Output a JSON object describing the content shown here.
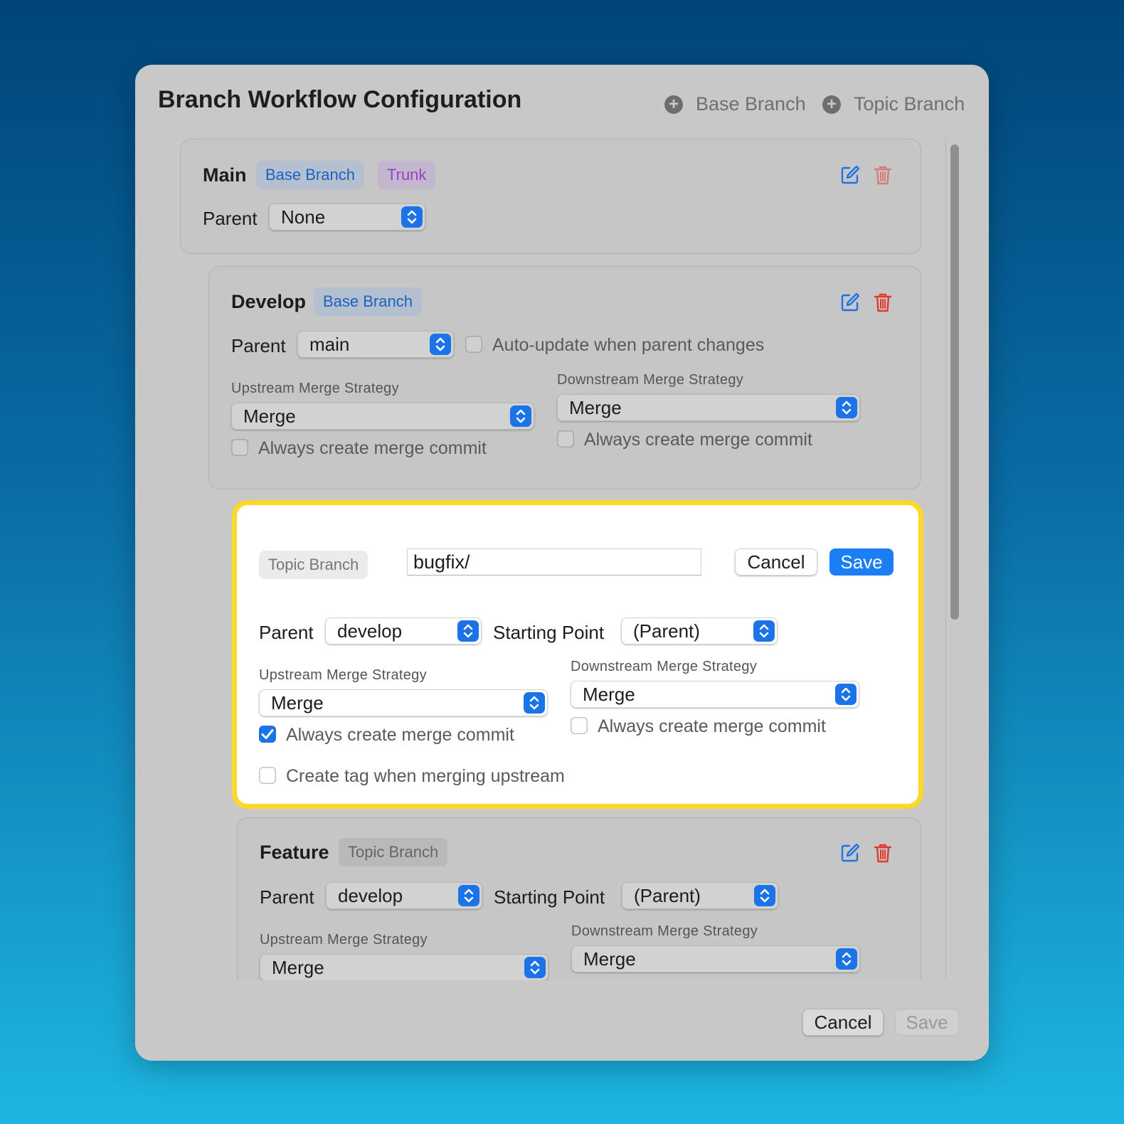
{
  "window": {
    "title": "Branch Workflow Configuration",
    "add_base_label": "Base Branch",
    "add_topic_label": "Topic Branch"
  },
  "colors": {
    "accent": "#1b73e8",
    "highlight_border": "#fcd928",
    "delete_red": "#e03a2e",
    "trunk_purple": "#9a3fc0"
  },
  "icons": [
    "plus-circle-icon",
    "edit-icon",
    "trash-icon",
    "chevron-up-down-icon",
    "checkmark-icon"
  ],
  "main": {
    "name": "Main",
    "badge_base": "Base Branch",
    "badge_trunk": "Trunk",
    "parent_label": "Parent",
    "parent_value": "None"
  },
  "develop": {
    "name": "Develop",
    "badge_base": "Base Branch",
    "parent_label": "Parent",
    "parent_value": "main",
    "auto_update_label": "Auto-update when parent changes",
    "auto_update_checked": false,
    "upstream_label": "Upstream Merge Strategy",
    "upstream_value": "Merge",
    "upstream_always_label": "Always create merge commit",
    "downstream_label": "Downstream Merge Strategy",
    "downstream_value": "Merge",
    "downstream_always_label": "Always create merge commit"
  },
  "editing": {
    "badge": "Topic Branch",
    "prefix_value": "bugfix/",
    "cancel_label": "Cancel",
    "save_label": "Save",
    "parent_label": "Parent",
    "parent_value": "develop",
    "starting_point_label": "Starting Point",
    "starting_point_value": "(Parent)",
    "upstream_label": "Upstream Merge Strategy",
    "upstream_value": "Merge",
    "upstream_always_label": "Always create merge commit",
    "upstream_always_checked": true,
    "downstream_label": "Downstream Merge Strategy",
    "downstream_value": "Merge",
    "downstream_always_label": "Always create merge commit",
    "downstream_always_checked": false,
    "create_tag_label": "Create tag when merging upstream",
    "create_tag_checked": false
  },
  "feature": {
    "name": "Feature",
    "badge": "Topic Branch",
    "parent_label": "Parent",
    "parent_value": "develop",
    "starting_point_label": "Starting Point",
    "starting_point_value": "(Parent)",
    "upstream_label": "Upstream Merge Strategy",
    "upstream_value": "Merge",
    "downstream_label": "Downstream Merge Strategy",
    "downstream_value": "Merge"
  },
  "footer": {
    "cancel_label": "Cancel",
    "save_label": "Save"
  }
}
